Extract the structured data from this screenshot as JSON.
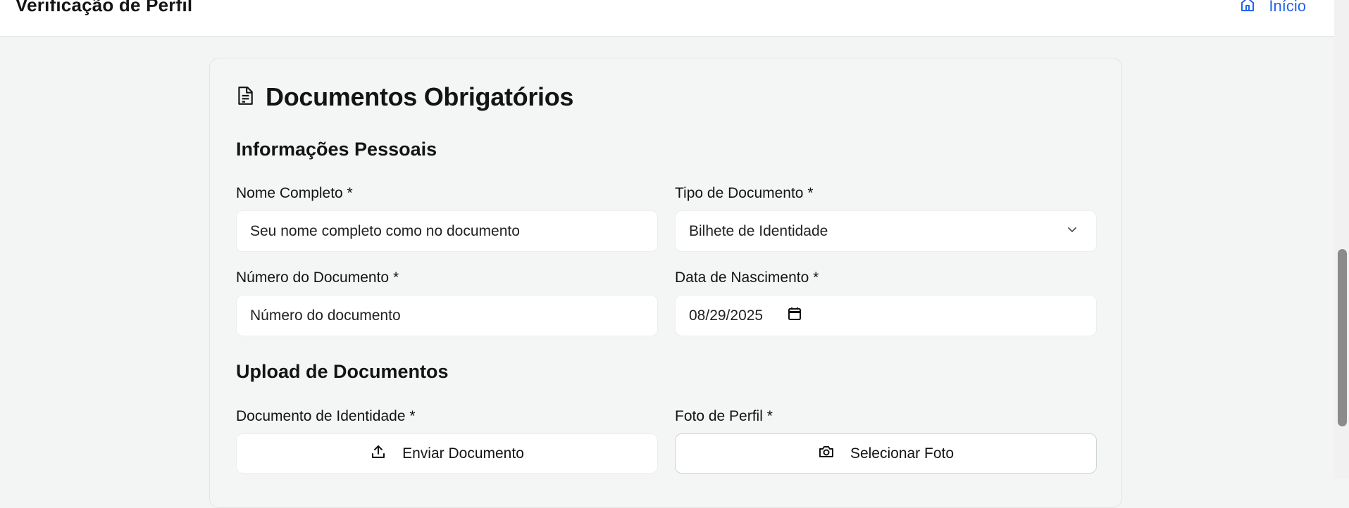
{
  "header": {
    "title": "Verificação de Perfil",
    "home_label": "Início"
  },
  "card": {
    "title": "Documentos Obrigatórios",
    "sections": {
      "personal": "Informações Pessoais",
      "upload": "Upload de Documentos"
    }
  },
  "form": {
    "full_name": {
      "label": "Nome Completo *",
      "placeholder": "Seu nome completo como no documento"
    },
    "doc_type": {
      "label": "Tipo de Documento *",
      "value": "Bilhete de Identidade"
    },
    "doc_number": {
      "label": "Número do Documento *",
      "placeholder": "Número do documento"
    },
    "birth_date": {
      "label": "Data de Nascimento *",
      "value": "08/29/2025"
    },
    "id_document": {
      "label": "Documento de Identidade *",
      "button": "Enviar Documento"
    },
    "profile_photo": {
      "label": "Foto de Perfil *",
      "button": "Selecionar Foto"
    }
  },
  "colors": {
    "accent": "#2563eb",
    "background": "#f3f5f4",
    "card": "#f4f6f5"
  },
  "icons": {
    "home": "home-icon",
    "document": "document-icon",
    "chevron": "chevron-down-icon",
    "calendar": "calendar-icon",
    "upload": "upload-icon",
    "camera": "camera-icon"
  }
}
